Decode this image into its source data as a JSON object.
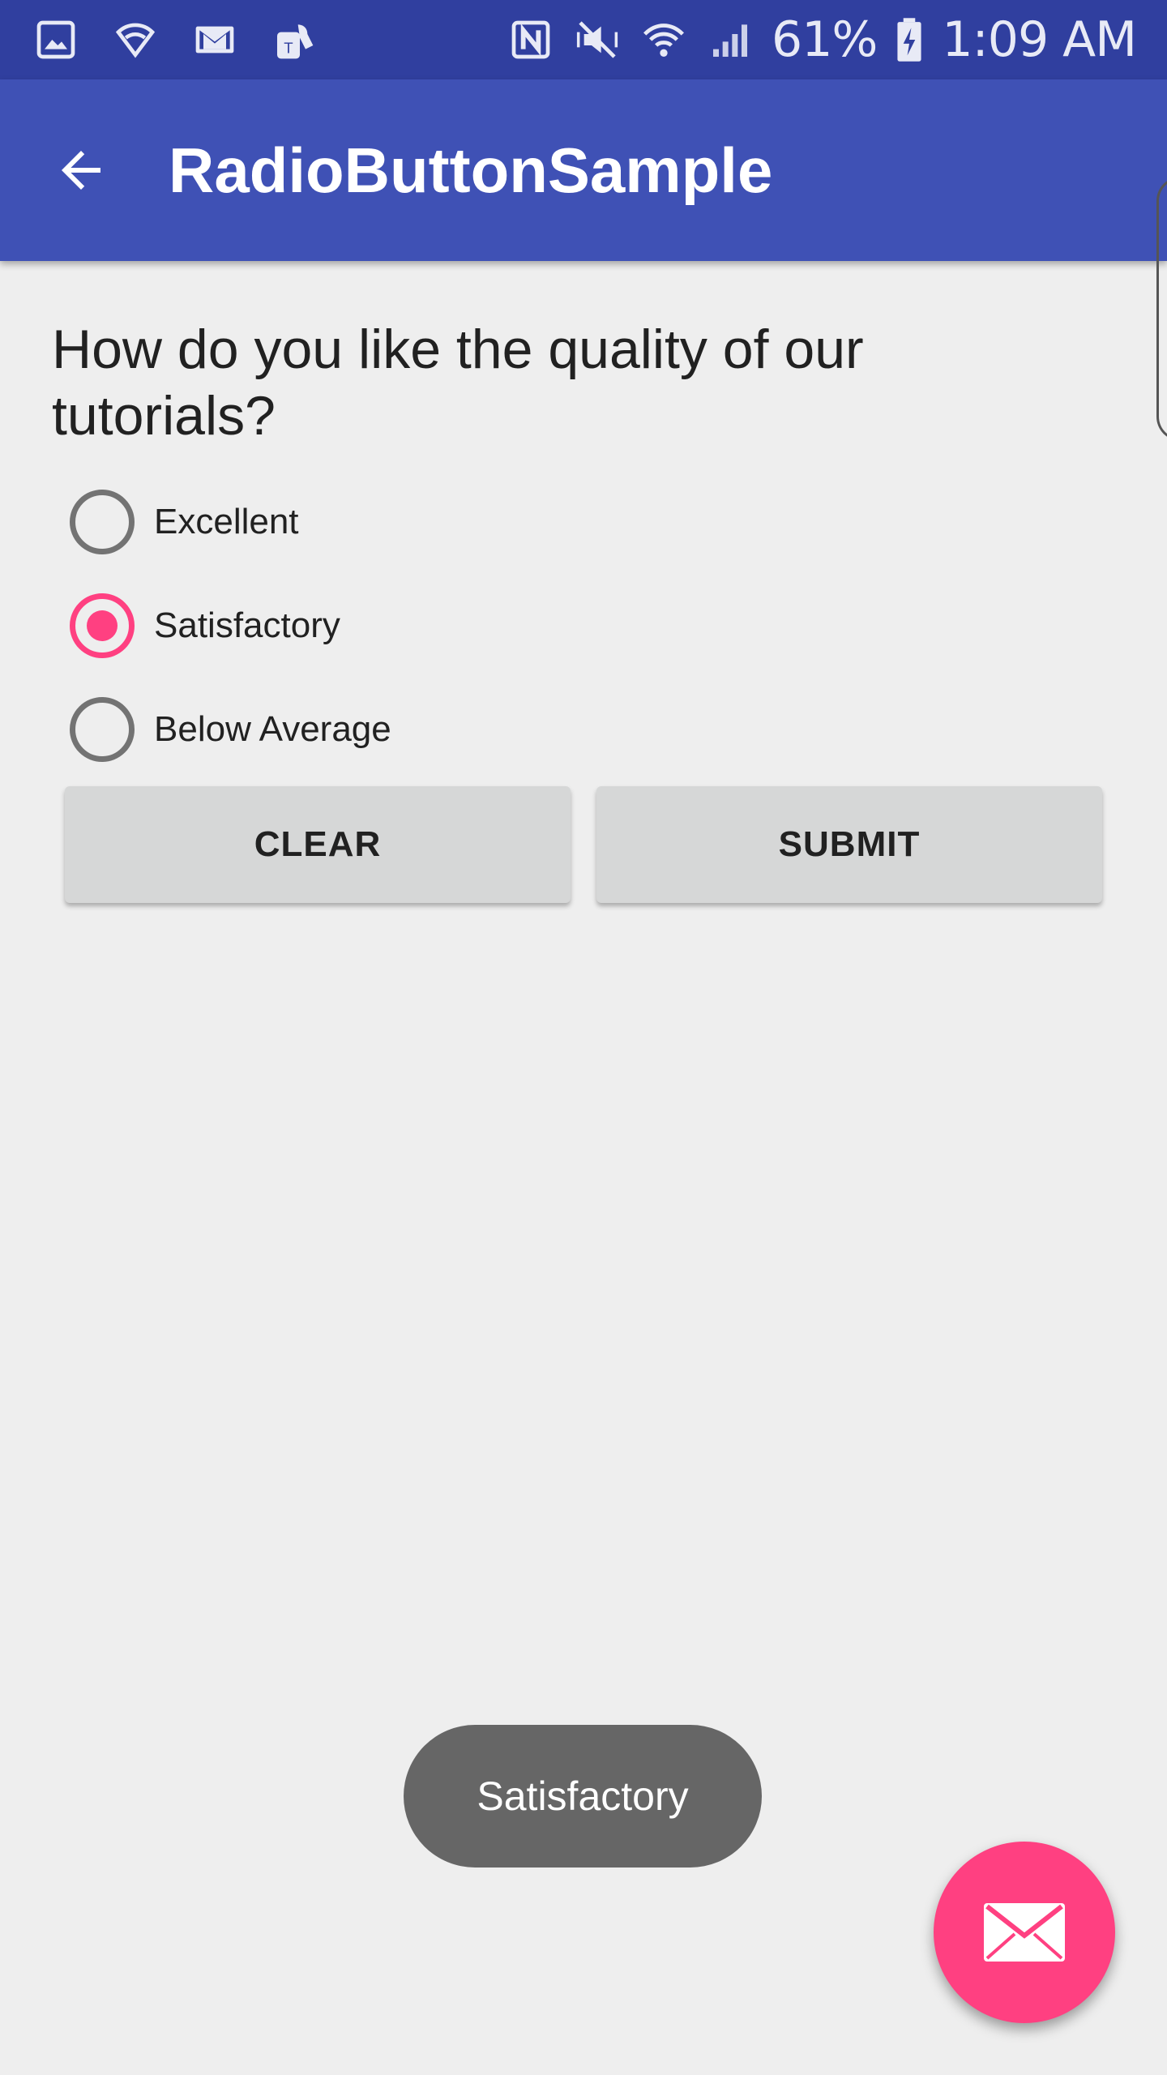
{
  "status_bar": {
    "icons_left": [
      "gallery-icon",
      "wifi-shield-icon",
      "gmail-icon",
      "tmobile-icon"
    ],
    "icons_right": [
      "nfc-icon",
      "mute-icon",
      "wifi-icon",
      "signal-icon"
    ],
    "battery": "61%",
    "time": "1:09 AM"
  },
  "app_bar": {
    "title": "RadioButtonSample",
    "back_icon": "arrow-back-icon"
  },
  "question": "How do you like the quality of our tutorials?",
  "options": [
    {
      "label": "Excellent",
      "checked": false
    },
    {
      "label": "Satisfactory",
      "checked": true
    },
    {
      "label": "Below Average",
      "checked": false
    }
  ],
  "buttons": {
    "clear": "CLEAR",
    "submit": "SUBMIT"
  },
  "toast": "Satisfactory",
  "fab_icon": "mail-icon",
  "colors": {
    "primary": "#3f51b5",
    "primary_dark": "#303f9f",
    "accent": "#ff4081",
    "button": "#d6d7d7",
    "background": "#eeeeee"
  }
}
